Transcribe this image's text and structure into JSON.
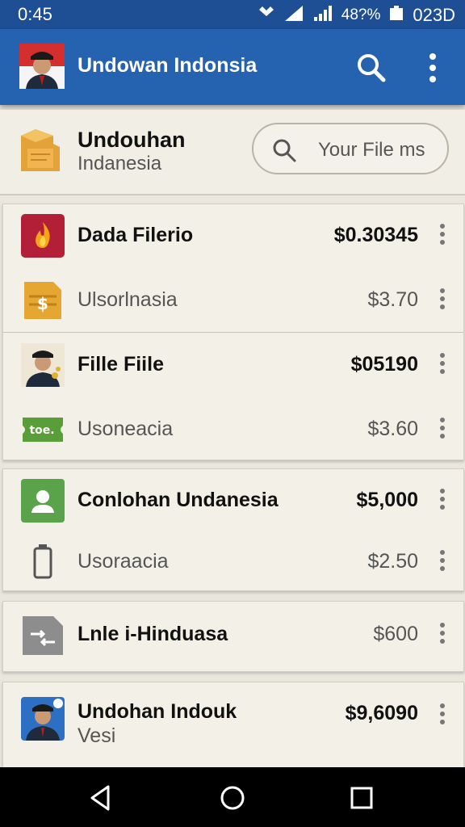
{
  "status": {
    "time": "0:45",
    "battery": "48?%",
    "clock": "023D"
  },
  "appbar": {
    "title": "Undowan Indonsia"
  },
  "header": {
    "title": "Undouhan",
    "subtitle": "Indanesia",
    "search_placeholder": "Your File ms"
  },
  "cards": [
    {
      "rows": [
        {
          "icon": "fire-icon",
          "name": "Dada Filerio",
          "price": "$0.30345",
          "primary": true
        },
        {
          "icon": "dollar-note-icon",
          "name": "Ulsorlnasia",
          "price": "$3.70",
          "primary": false
        }
      ]
    },
    {
      "rows": [
        {
          "icon": "officer-avatar-icon",
          "name": "Fille Fiile",
          "price": "$05190",
          "primary": true
        },
        {
          "icon": "ticket-icon",
          "icon_text": "toe.",
          "name": "Usoneacia",
          "price": "$3.60",
          "primary": false
        }
      ]
    },
    {
      "rows": [
        {
          "icon": "contact-icon",
          "name": "Conlohan Undanesia",
          "price": "$5,000",
          "primary": true
        },
        {
          "icon": "battery-icon",
          "name": "Usoraacia",
          "price": "$2.50",
          "primary": false
        }
      ]
    },
    {
      "rows": [
        {
          "icon": "file-transfer-icon",
          "name": "Lnle i-Hinduasa",
          "price": "$600",
          "primary": false
        }
      ]
    },
    {
      "rows": [
        {
          "icon": "officer-avatar-icon",
          "name": "Undohan Indouk",
          "subname": "Vesi",
          "price": "$9,6090",
          "primary": true
        }
      ]
    }
  ],
  "colors": {
    "appbar": "#2563b0",
    "statusbar": "#1e4f94",
    "background": "#e9e6dd"
  }
}
